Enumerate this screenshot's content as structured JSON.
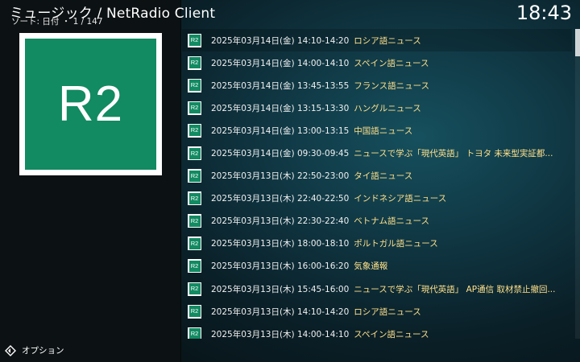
{
  "header": {
    "title": "ミュージック / NetRadio Client",
    "sort_label": "ソート: 日付",
    "page_indicator": "・ 1 / 147",
    "clock": "18:43"
  },
  "thumbnail": {
    "text": "R2",
    "color": "#128a62"
  },
  "options": {
    "label": "オプション",
    "icon": "options-icon"
  },
  "list": {
    "icon_text": "R2",
    "items": [
      {
        "date": "2025年03月14日(金) 14:10-14:20",
        "title": "ロシア語ニュース"
      },
      {
        "date": "2025年03月14日(金) 14:00-14:10",
        "title": "スペイン語ニュース"
      },
      {
        "date": "2025年03月14日(金) 13:45-13:55",
        "title": "フランス語ニュース"
      },
      {
        "date": "2025年03月14日(金) 13:15-13:30",
        "title": "ハングルニュース"
      },
      {
        "date": "2025年03月14日(金) 13:00-13:15",
        "title": "中国語ニュース"
      },
      {
        "date": "2025年03月14日(金) 09:30-09:45",
        "title": "ニュースで学ぶ「現代英語」 トヨタ 未来型実証都..."
      },
      {
        "date": "2025年03月13日(木) 22:50-23:00",
        "title": "タイ語ニュース"
      },
      {
        "date": "2025年03月13日(木) 22:40-22:50",
        "title": "インドネシア語ニュース"
      },
      {
        "date": "2025年03月13日(木) 22:30-22:40",
        "title": "ベトナム語ニュース"
      },
      {
        "date": "2025年03月13日(木) 18:00-18:10",
        "title": "ポルトガル語ニュース"
      },
      {
        "date": "2025年03月13日(木) 16:00-16:20",
        "title": "気象通報"
      },
      {
        "date": "2025年03月13日(木) 15:45-16:00",
        "title": "ニュースで学ぶ「現代英語」 AP通信 取材禁止撤回..."
      },
      {
        "date": "2025年03月13日(木) 14:10-14:20",
        "title": "ロシア語ニュース"
      },
      {
        "date": "2025年03月13日(木) 14:00-14:10",
        "title": "スペイン語ニュース"
      }
    ]
  }
}
